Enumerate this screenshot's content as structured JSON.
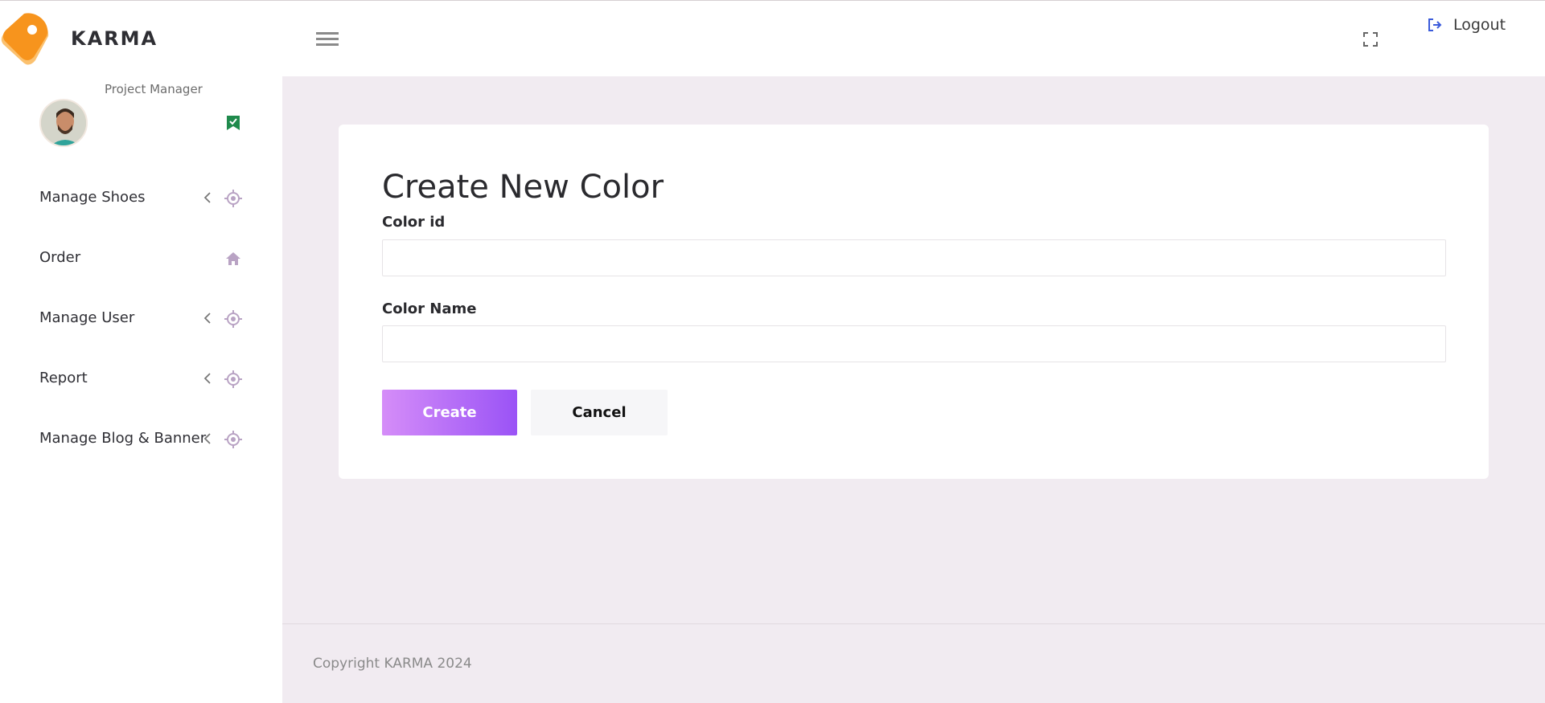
{
  "brand": {
    "name": "KARMA"
  },
  "profile": {
    "role": "Project Manager"
  },
  "sidebar": {
    "items": [
      {
        "label": "Manage Shoes",
        "has_chevron": true,
        "icon": "target-icon"
      },
      {
        "label": "Order",
        "has_chevron": false,
        "icon": "home-icon"
      },
      {
        "label": "Manage User",
        "has_chevron": true,
        "icon": "target-icon"
      },
      {
        "label": "Report",
        "has_chevron": true,
        "icon": "target-icon"
      },
      {
        "label": "Manage Blog & Banner",
        "has_chevron": true,
        "icon": "target-icon"
      }
    ]
  },
  "topbar": {
    "logout_label": "Logout"
  },
  "form": {
    "title": "Create New Color",
    "color_id_label": "Color id",
    "color_id_value": "",
    "color_name_label": "Color Name",
    "color_name_value": "",
    "create_label": "Create",
    "cancel_label": "Cancel"
  },
  "footer": {
    "copyright": "Copyright KARMA 2024"
  },
  "colors": {
    "accent_start": "#d58df8",
    "accent_end": "#9a53f6",
    "main_background": "#f1ebf1",
    "logo_orange": "#f7941d",
    "badge_green": "#1f8a4c",
    "nav_icon": "#b9a3c4",
    "logout_icon": "#3b5bdb"
  }
}
